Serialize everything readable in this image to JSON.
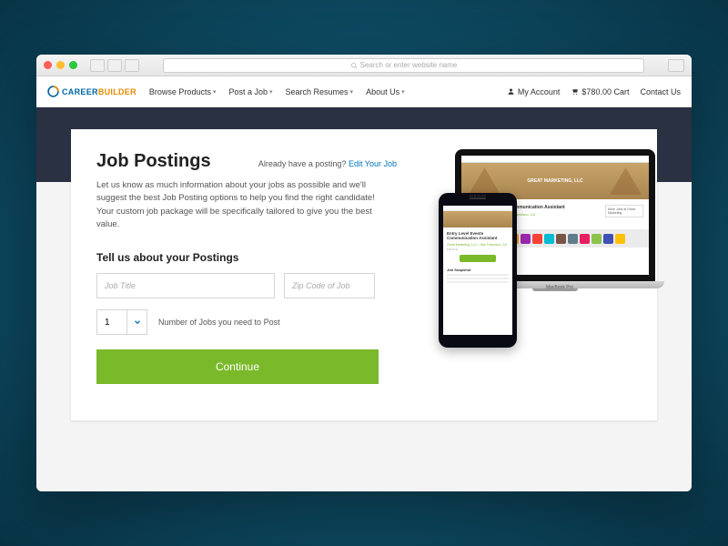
{
  "browser": {
    "url_placeholder": "Search or enter website name"
  },
  "nav": {
    "brand_a": "CAREER",
    "brand_b": "BUILDER",
    "links": {
      "browse": "Browse Products",
      "post": "Post a Job",
      "resumes": "Search Resumes",
      "about": "About Us"
    },
    "account": "My Account",
    "cart": "$780.00 Cart",
    "contact": "Contact Us"
  },
  "page": {
    "title": "Job Postings",
    "already_text": "Already have a posting?",
    "edit_link": "Edit Your Job",
    "lead": "Let us know as much information about your jobs as possible and we'll suggest the best Job Posting options to help you find the right candidate! Your custom job package will be specifically tailored to give you the best value.",
    "form_heading": "Tell us about your Postings",
    "job_title_placeholder": "Job Title",
    "zip_placeholder": "Zip Code of Job",
    "num_value": "1",
    "num_label": "Number of Jobs you need to Post",
    "continue": "Continue"
  },
  "devices": {
    "phone_brand": "SAMSUNG",
    "laptop_brand": "MacBook Pro",
    "site": {
      "hero": "GREAT MARKETING, LLC",
      "job_title": "Entry Level Events Communication Assistant",
      "company": "Great Marketing, LLC",
      "location": "San Francisco, CA",
      "snapshot": "Job Snapshot",
      "side_title": "More Jobs at Great Marketing"
    }
  }
}
